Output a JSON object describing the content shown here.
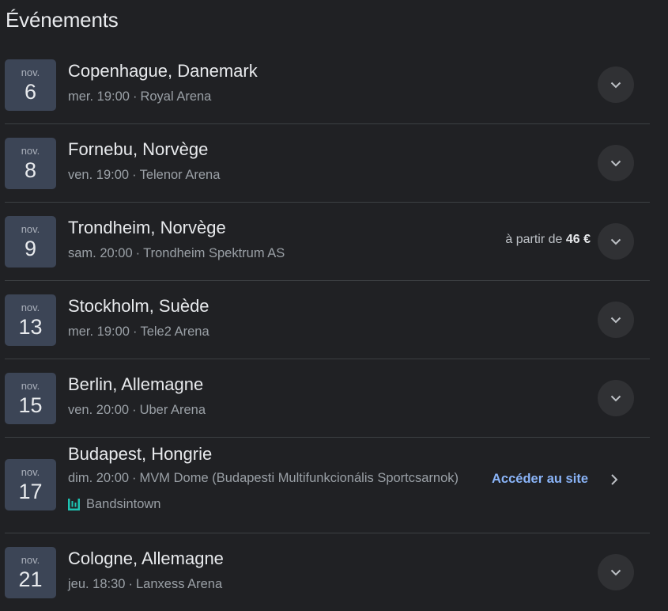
{
  "heading": "Événements",
  "events": [
    {
      "month": "nov.",
      "day": "6",
      "city": "Copenhague, Danemark",
      "time": "mer. 19:00",
      "venue": "Royal Arena"
    },
    {
      "month": "nov.",
      "day": "8",
      "city": "Fornebu, Norvège",
      "time": "ven. 19:00",
      "venue": "Telenor Arena"
    },
    {
      "month": "nov.",
      "day": "9",
      "city": "Trondheim, Norvège",
      "time": "sam. 20:00",
      "venue": "Trondheim Spektrum AS",
      "price_prefix": "à partir de",
      "price": "46 €"
    },
    {
      "month": "nov.",
      "day": "13",
      "city": "Stockholm, Suède",
      "time": "mer. 19:00",
      "venue": "Tele2 Arena"
    },
    {
      "month": "nov.",
      "day": "15",
      "city": "Berlin, Allemagne",
      "time": "ven. 20:00",
      "venue": "Uber Arena"
    },
    {
      "month": "nov.",
      "day": "17",
      "city": "Budapest, Hongrie",
      "time": "dim. 20:00",
      "venue": "MVM Dome (Budapesti Multifunkcionális Sportcsarnok)",
      "link_label": "Accéder au site",
      "provider": "Bandsintown"
    },
    {
      "month": "nov.",
      "day": "21",
      "city": "Cologne, Allemagne",
      "time": "jeu. 18:30",
      "venue": "Lanxess Arena"
    }
  ],
  "separator": "·",
  "icons": {
    "expand": "chevron-down-icon",
    "open": "chevron-right-icon",
    "provider": "bandsintown-icon"
  },
  "colors": {
    "background": "#202124",
    "date_badge": "#3c4556",
    "link": "#8ab4f8",
    "provider_icon": "#1ec3b2"
  }
}
